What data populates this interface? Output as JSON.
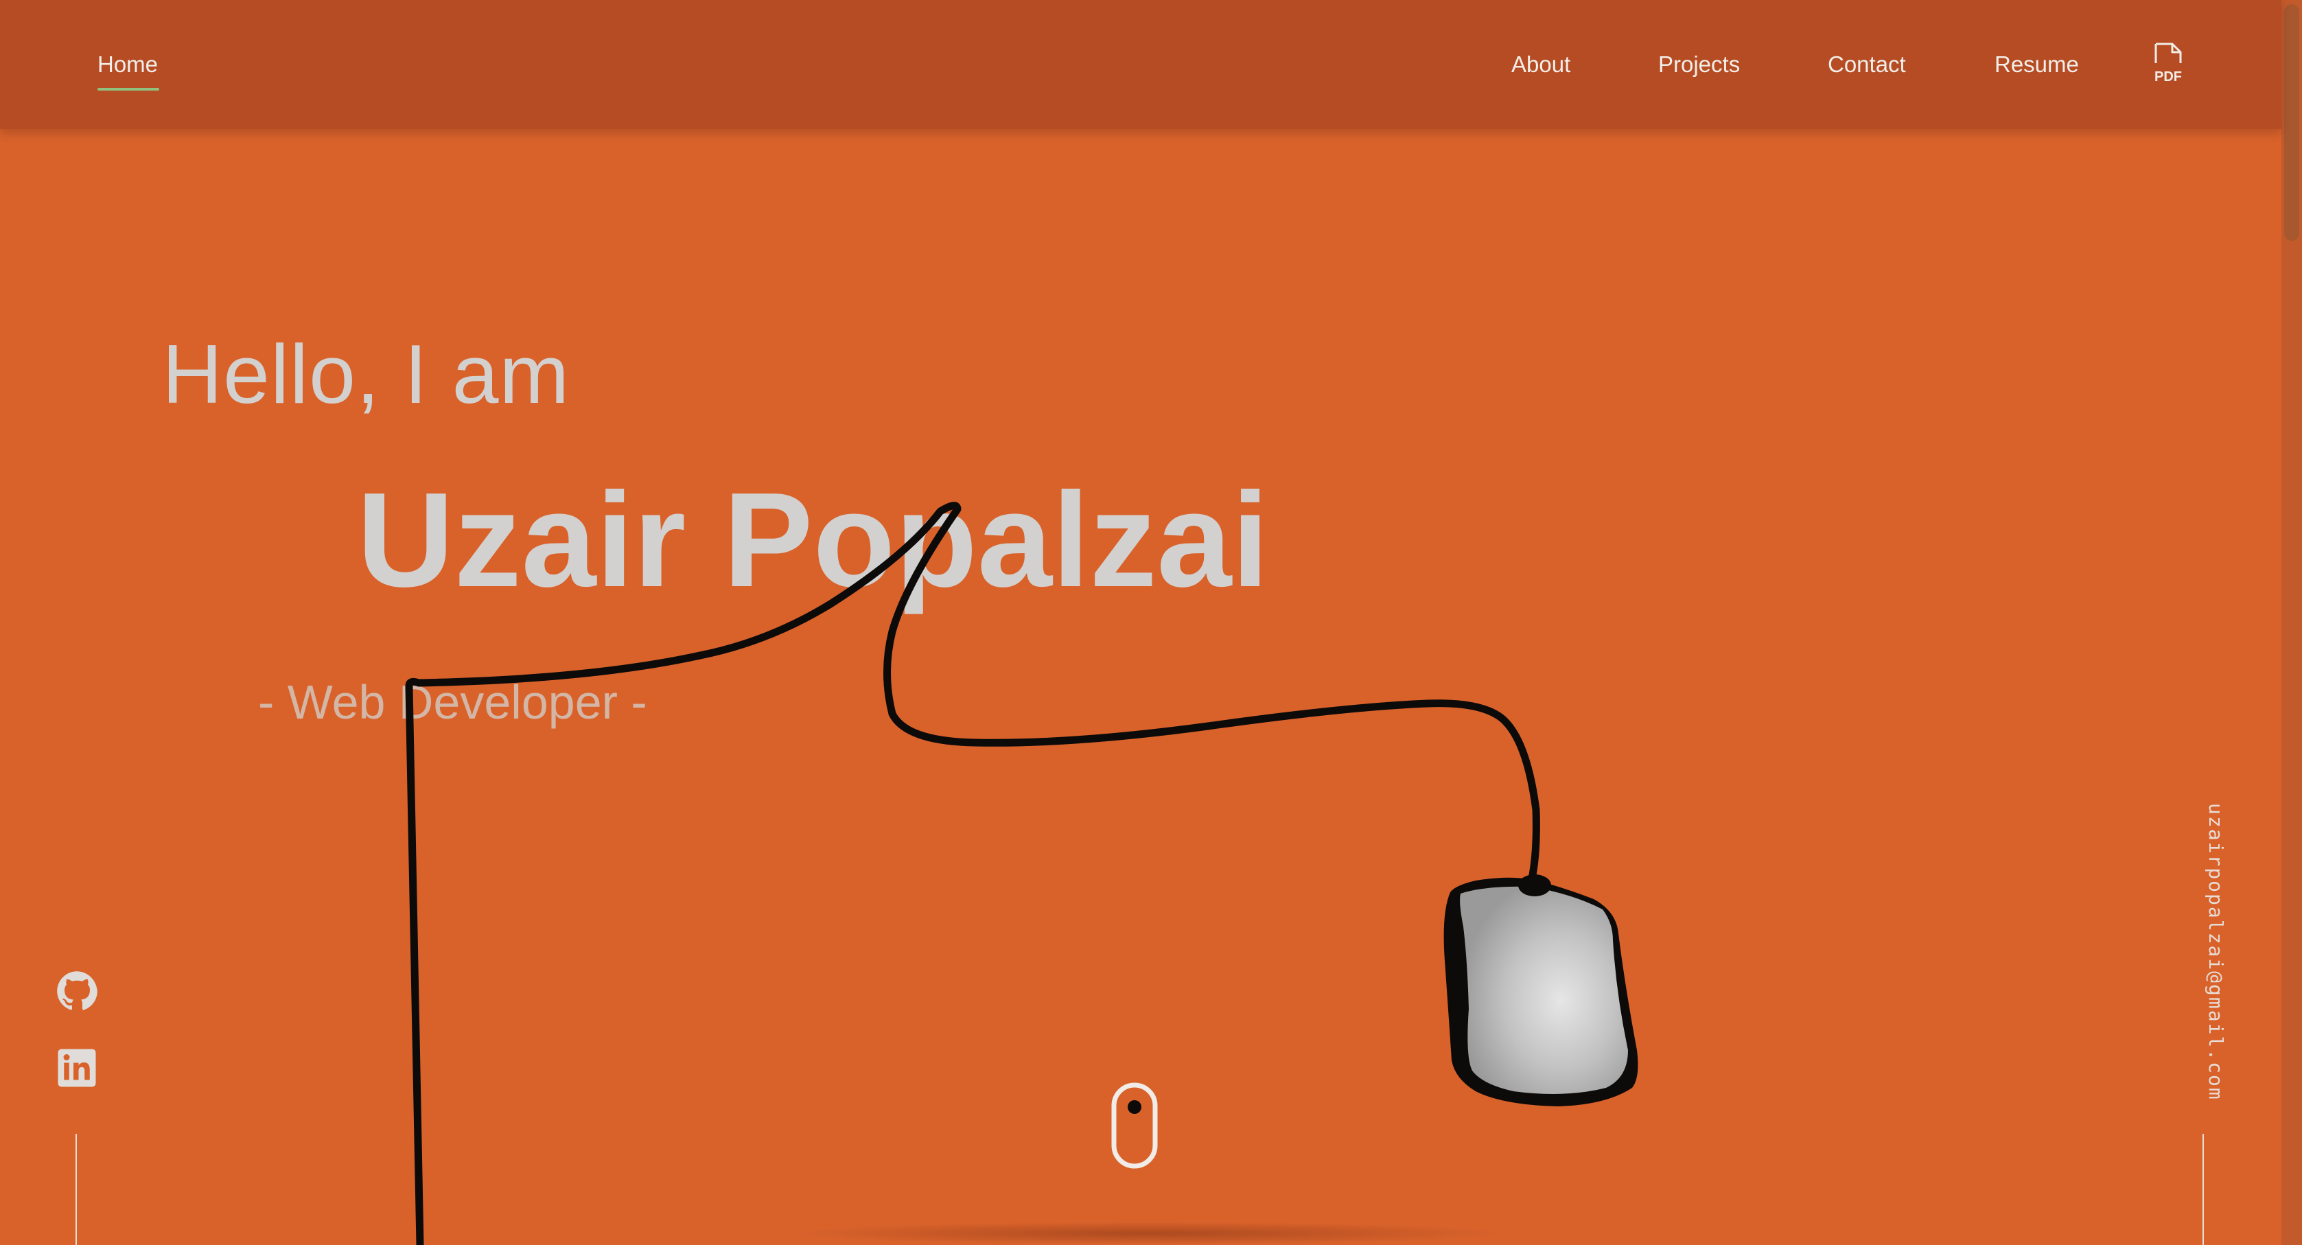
{
  "nav": {
    "home": "Home",
    "about": "About",
    "projects": "Projects",
    "contact": "Contact",
    "resume": "Resume",
    "pdf_label": "PDF"
  },
  "hero": {
    "greeting": "Hello, I am",
    "name": "Uzair Popalzai",
    "role": "- Web Developer -"
  },
  "sidebar": {
    "email": "uzairpopalzai@gmail.com",
    "socials": [
      {
        "icon": "github-icon"
      },
      {
        "icon": "linkedin-icon"
      }
    ]
  },
  "colors": {
    "background": "#d9622b",
    "navbar": "#b54c23",
    "text_light": "#d3d1cf",
    "active_underline": "#8fc17f"
  }
}
